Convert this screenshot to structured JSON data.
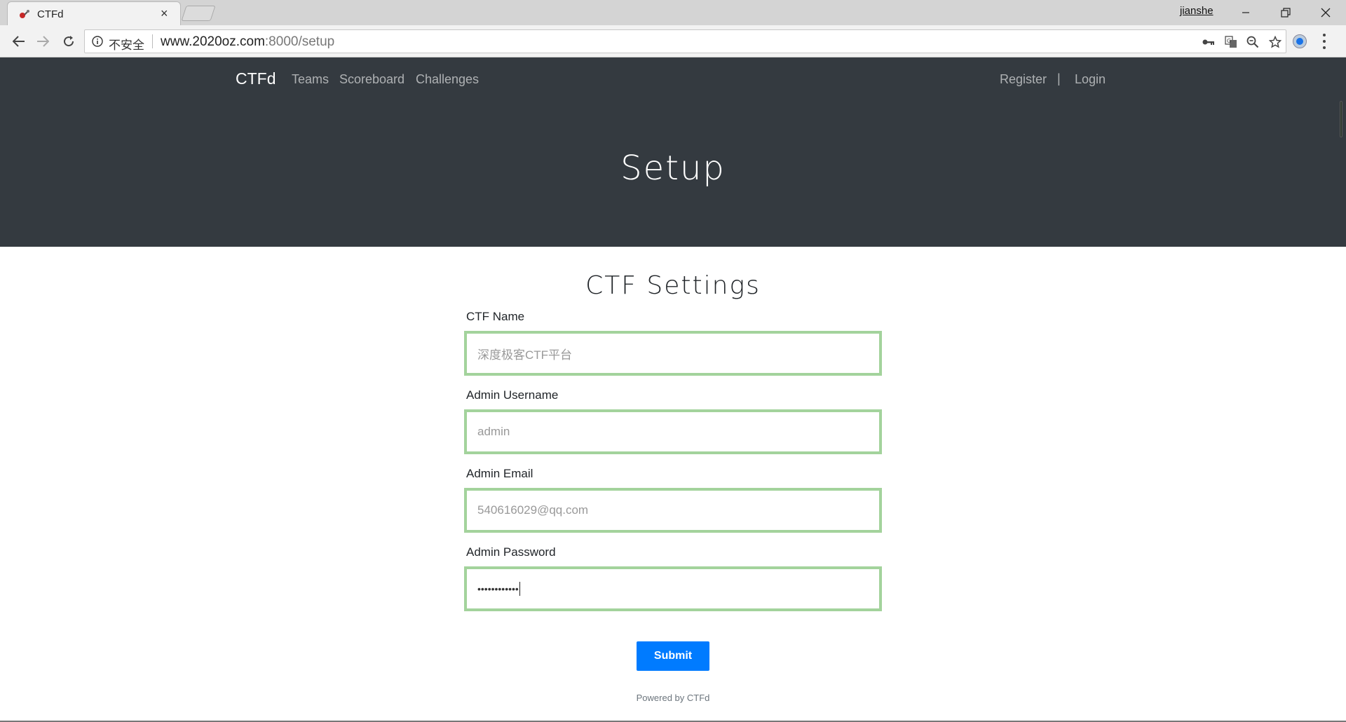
{
  "browser": {
    "tab_title": "CTFd",
    "profile_name": "jianshe",
    "security_label": "不安全",
    "url_host": "www.2020oz.com",
    "url_rest": ":8000/setup"
  },
  "navbar": {
    "brand": "CTFd",
    "links": [
      "Teams",
      "Scoreboard",
      "Challenges"
    ],
    "register": "Register",
    "divider": "|",
    "login": "Login"
  },
  "hero": {
    "title": "Setup"
  },
  "form": {
    "title": "CTF Settings",
    "fields": [
      {
        "label": "CTF Name",
        "placeholder": "深度极客CTF平台"
      },
      {
        "label": "Admin Username",
        "placeholder": "admin"
      },
      {
        "label": "Admin Email",
        "placeholder": "540616029@qq.com"
      },
      {
        "label": "Admin Password",
        "value": "••••••••••••"
      }
    ],
    "submit": "Submit"
  },
  "footer": {
    "powered_by": "Powered by CTFd"
  },
  "colors": {
    "navbar_bg": "#343a40",
    "input_border_valid": "#a3d39c",
    "primary": "#007bff"
  }
}
